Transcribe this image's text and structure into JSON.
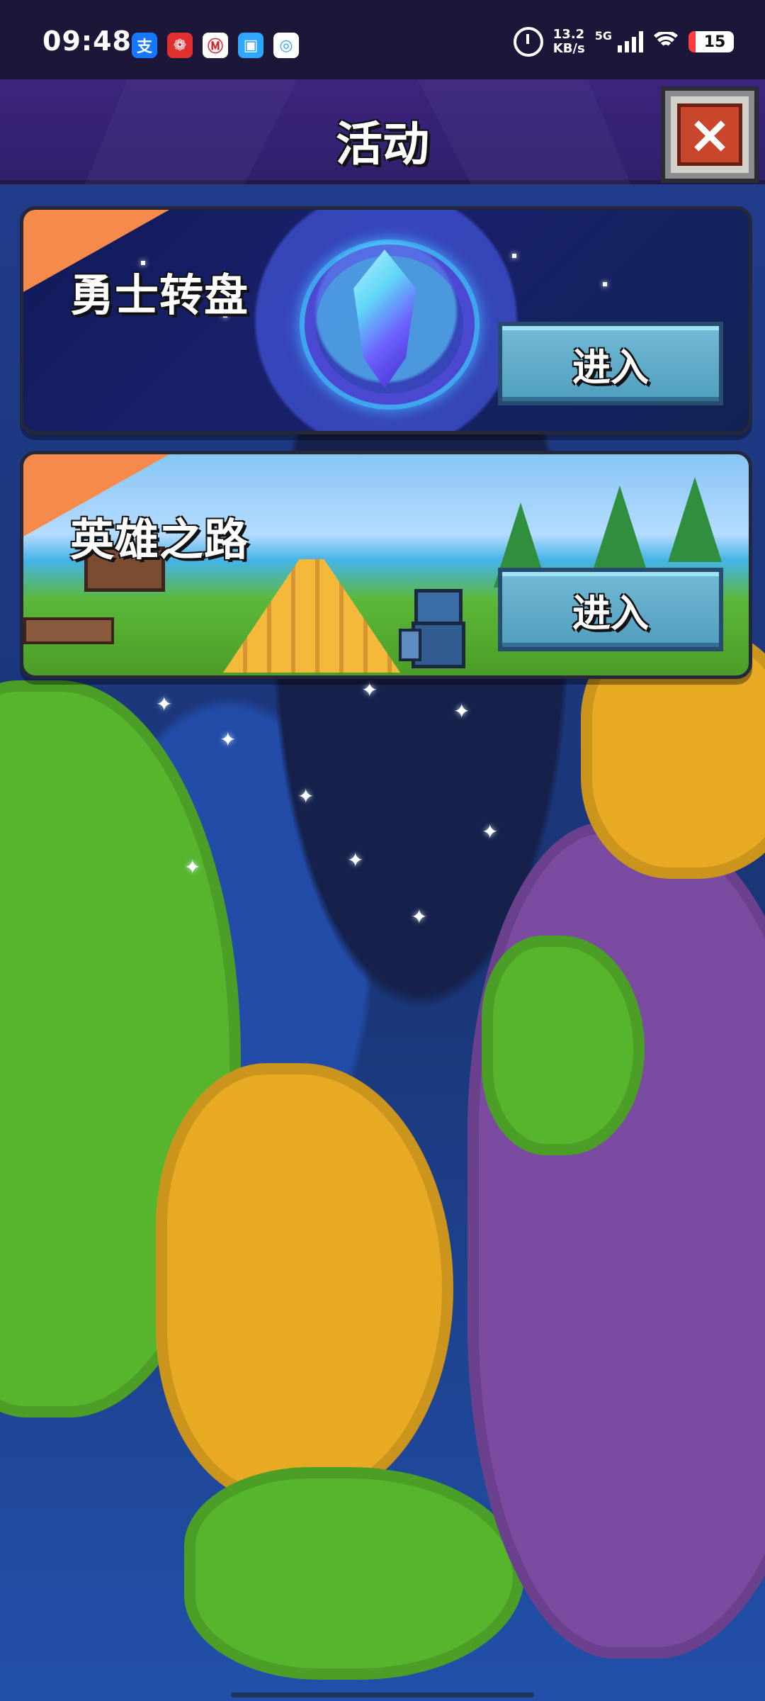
{
  "status_bar": {
    "time": "09:48",
    "network_speed": {
      "value": "13.2",
      "unit": "KB/s"
    },
    "network_type": "5G",
    "battery_level": "15",
    "app_icons": [
      {
        "name": "alipay-icon",
        "label": "支",
        "color": "#1677ff"
      },
      {
        "name": "lotus-app-icon",
        "label": "❁",
        "color": "#df2f2f"
      },
      {
        "name": "bank-app-icon",
        "label": "Ⓜ",
        "color": "#d9252b"
      },
      {
        "name": "messaging-app-icon",
        "label": "▣",
        "color": "#2fa7ff"
      },
      {
        "name": "colorful-app-icon",
        "label": "◎",
        "color": "#ffffff"
      }
    ]
  },
  "header": {
    "title": "活动",
    "close_icon": "close-icon"
  },
  "activities": [
    {
      "title": "勇士转盘",
      "button_label": "进入"
    },
    {
      "title": "英雄之路",
      "button_label": "进入"
    }
  ],
  "theme_colors": {
    "header": "#3b247e",
    "button": "#5ea8c8",
    "corner_flag": "#f58a4b",
    "map_water": "#1e3f91",
    "map_green": "#56b52d",
    "map_yellow": "#e8aa22",
    "map_purple": "#7a4ba1"
  }
}
